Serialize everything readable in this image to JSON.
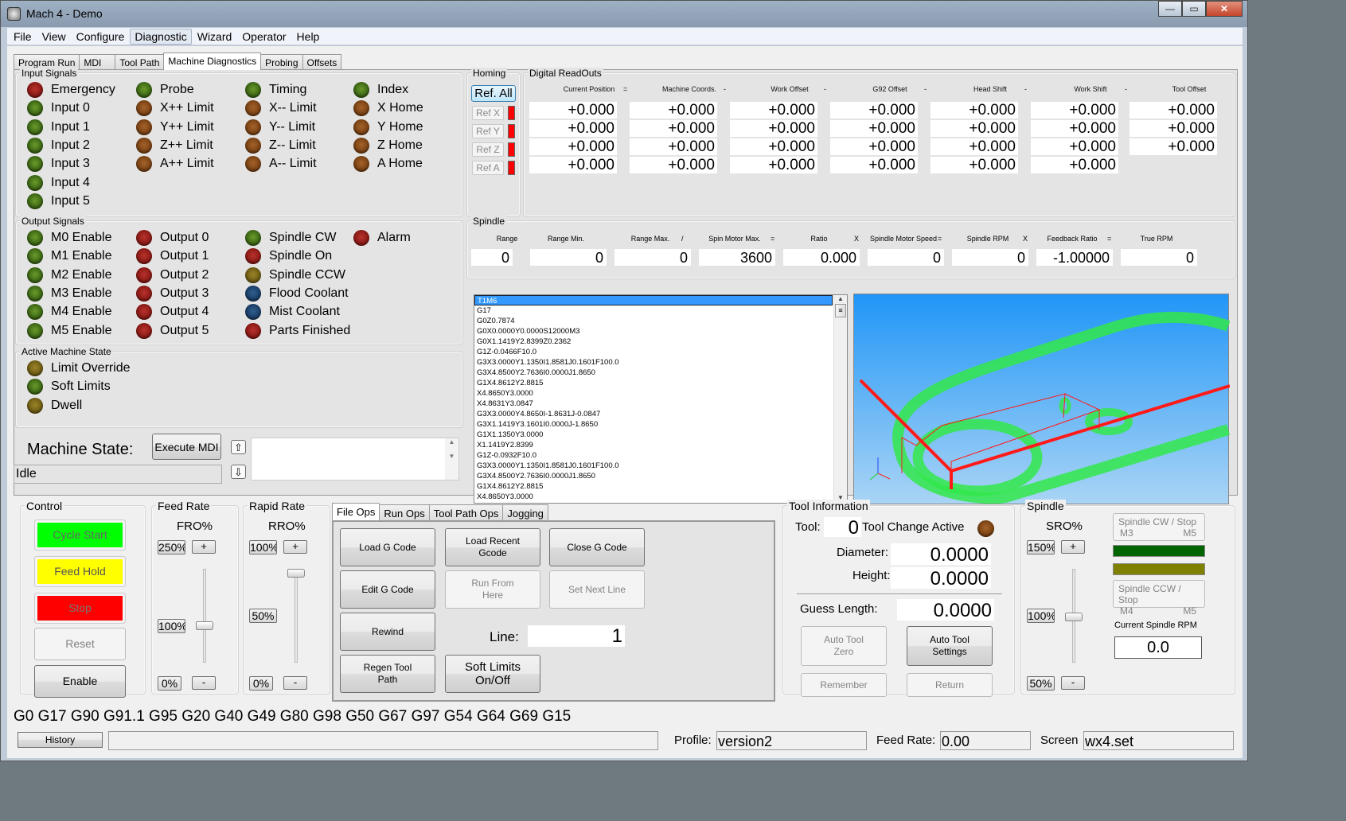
{
  "window": {
    "title": "Mach 4 - Demo",
    "buttons": {
      "minimize": "—",
      "maximize": "▭",
      "close": "✕"
    }
  },
  "menu": [
    "File",
    "View",
    "Configure",
    "Diagnostic",
    "Wizard",
    "Operator",
    "Help"
  ],
  "active_menu": "Diagnostic",
  "tabs": [
    "Program Run",
    "MDI",
    "Tool Path",
    "Machine Diagnostics",
    "Probing",
    "Offsets"
  ],
  "active_tab": "Machine Diagnostics",
  "input_signals": {
    "title": "Input Signals",
    "items": [
      {
        "label": "Emergency",
        "state": "red"
      },
      {
        "label": "Input 0",
        "state": "green"
      },
      {
        "label": "Input 1",
        "state": "green"
      },
      {
        "label": "Input 2",
        "state": "green"
      },
      {
        "label": "Input 3",
        "state": "green"
      },
      {
        "label": "Input 4",
        "state": "green"
      },
      {
        "label": "Input 5",
        "state": "green"
      },
      {
        "label": "Probe",
        "state": "green"
      },
      {
        "label": "X++ Limit",
        "state": "brown"
      },
      {
        "label": "Y++ Limit",
        "state": "brown"
      },
      {
        "label": "Z++ Limit",
        "state": "brown"
      },
      {
        "label": "A++ Limit",
        "state": "brown"
      },
      {
        "label": "Timing",
        "state": "green"
      },
      {
        "label": "X-- Limit",
        "state": "brown"
      },
      {
        "label": "Y-- Limit",
        "state": "brown"
      },
      {
        "label": "Z-- Limit",
        "state": "brown"
      },
      {
        "label": "A-- Limit",
        "state": "brown"
      },
      {
        "label": "Index",
        "state": "green"
      },
      {
        "label": "X Home",
        "state": "brown"
      },
      {
        "label": "Y Home",
        "state": "brown"
      },
      {
        "label": "Z Home",
        "state": "brown"
      },
      {
        "label": "A Home",
        "state": "brown"
      }
    ]
  },
  "output_signals": {
    "title": "Output Signals",
    "items": [
      {
        "label": "M0 Enable",
        "state": "green"
      },
      {
        "label": "M1 Enable",
        "state": "green"
      },
      {
        "label": "M2 Enable",
        "state": "green"
      },
      {
        "label": "M3 Enable",
        "state": "green"
      },
      {
        "label": "M4 Enable",
        "state": "green"
      },
      {
        "label": "M5 Enable",
        "state": "green"
      },
      {
        "label": "Output 0",
        "state": "red"
      },
      {
        "label": "Output 1",
        "state": "red"
      },
      {
        "label": "Output 2",
        "state": "red"
      },
      {
        "label": "Output 3",
        "state": "red"
      },
      {
        "label": "Output 4",
        "state": "red"
      },
      {
        "label": "Output 5",
        "state": "red"
      },
      {
        "label": "Spindle CW",
        "state": "green"
      },
      {
        "label": "Spindle On",
        "state": "red"
      },
      {
        "label": "Spindle CCW",
        "state": "olive"
      },
      {
        "label": "Flood Coolant",
        "state": "blue"
      },
      {
        "label": "Mist Coolant",
        "state": "blue"
      },
      {
        "label": "Parts Finished",
        "state": "red"
      },
      {
        "label": "Alarm",
        "state": "red"
      }
    ]
  },
  "active_machine_state": {
    "title": "Active Machine State",
    "items": [
      {
        "label": "Limit Override",
        "state": "olive"
      },
      {
        "label": "Soft Limits",
        "state": "green"
      },
      {
        "label": "Dwell",
        "state": "olive"
      }
    ]
  },
  "machine_state": {
    "label": "Machine State:",
    "value": "Idle",
    "execute_mdi": "Execute MDI"
  },
  "homing": {
    "title": "Homing",
    "ref_all": "Ref. All",
    "axes": [
      "Ref X",
      "Ref Y",
      "Ref Z",
      "Ref A"
    ]
  },
  "dro": {
    "title": "Digital ReadOuts",
    "headers": [
      "Current Position",
      "Machine Coords.",
      "Work Offset",
      "G92 Offset",
      "Head Shift",
      "Work Shift",
      "Tool Offset"
    ],
    "operators": [
      "=",
      "-",
      "-",
      "-",
      "-",
      "-"
    ],
    "rows": [
      [
        "+0.000",
        "+0.000",
        "+0.000",
        "+0.000",
        "+0.000",
        "+0.000",
        "+0.000"
      ],
      [
        "+0.000",
        "+0.000",
        "+0.000",
        "+0.000",
        "+0.000",
        "+0.000",
        "+0.000"
      ],
      [
        "+0.000",
        "+0.000",
        "+0.000",
        "+0.000",
        "+0.000",
        "+0.000",
        "+0.000"
      ],
      [
        "+0.000",
        "+0.000",
        "+0.000",
        "+0.000",
        "+0.000",
        "+0.000",
        null
      ]
    ]
  },
  "spindle_calc": {
    "title": "Spindle",
    "headers": [
      "Range",
      "Range Min.",
      "Range Max.",
      "Spin Motor Max.",
      "Ratio",
      "Spindle Motor Speed",
      "Spindle RPM",
      "Feedback Ratio",
      "True RPM"
    ],
    "operators": [
      "",
      "",
      "/",
      "=",
      "X",
      "=",
      "X",
      "="
    ],
    "values": [
      "0",
      "0",
      "0",
      "3600",
      "0.000",
      "0",
      "0",
      "-1.00000",
      "0"
    ]
  },
  "gcode_lines": [
    "T1M6",
    "G17",
    "G0Z0.7874",
    "G0X0.0000Y0.0000S12000M3",
    "G0X1.1419Y2.8399Z0.2362",
    "G1Z-0.0466F10.0",
    "G3X3.0000Y1.1350I1.8581J0.1601F100.0",
    "G3X4.8500Y2.7636I0.0000J1.8650",
    "G1X4.8612Y2.8815",
    "X4.8650Y3.0000",
    "X4.8631Y3.0847",
    "G3X3.0000Y4.8650I-1.8631J-0.0847",
    "G3X1.1419Y3.1601I0.0000J-1.8650",
    "G1X1.1350Y3.0000",
    "X1.1419Y2.8399",
    "G1Z-0.0932F10.0",
    "G3X3.0000Y1.1350I1.8581J0.1601F100.0",
    "G3X4.8500Y2.7636I0.0000J1.8650",
    "G1X4.8612Y2.8815",
    "X4.8650Y3.0000"
  ],
  "control": {
    "title": "Control",
    "cycle_start": "Cycle Start",
    "feed_hold": "Feed Hold",
    "stop": "Stop",
    "reset": "Reset",
    "enable": "Enable",
    "colors": {
      "cycle_start": "#00ff00",
      "feed_hold": "#ffff00",
      "stop": "#ff0000"
    }
  },
  "feed_rate": {
    "title": "Feed Rate",
    "label": "FRO%",
    "max": "250%",
    "current": "100%",
    "min": "0%",
    "value_percent": 100,
    "range_percent": [
      0,
      250
    ]
  },
  "rapid_rate": {
    "title": "Rapid Rate",
    "label": "RRO%",
    "max": "100%",
    "current": "50%",
    "min": "0%",
    "value_percent": 100,
    "range_percent": [
      0,
      100
    ]
  },
  "file_ops": {
    "tabs": [
      "File Ops",
      "Run Ops",
      "Tool Path Ops",
      "Jogging"
    ],
    "active_tab": "File Ops",
    "load_gcode": "Load G Code",
    "load_recent": "Load Recent Gcode",
    "close_gcode": "Close G Code",
    "edit_gcode": "Edit G Code",
    "run_from_here": "Run From Here",
    "set_next_line": "Set Next Line",
    "rewind": "Rewind",
    "line_label": "Line:",
    "line_value": "1",
    "regen": "Regen Tool Path",
    "soft_limits": "Soft Limits On/Off"
  },
  "tool_info": {
    "title": "Tool Information",
    "tool_label": "Tool:",
    "tool_value": "0",
    "tool_change_active": "Tool Change Active",
    "diameter_label": "Diameter:",
    "diameter_value": "0.0000",
    "height_label": "Height:",
    "height_value": "0.0000",
    "guess_label": "Guess Length:",
    "guess_value": "0.0000",
    "auto_tool_zero": "Auto Tool Zero",
    "auto_tool_settings": "Auto Tool Settings",
    "remember": "Remember",
    "return": "Return"
  },
  "spindle_panel": {
    "title": "Spindle",
    "label": "SRO%",
    "max": "150%",
    "current": "100%",
    "min": "50%",
    "value_percent": 100,
    "range_percent": [
      50,
      150
    ],
    "cw_stop": {
      "line1": "Spindle CW / Stop",
      "m_on": "M3",
      "m_off": "M5"
    },
    "ccw_stop": {
      "line1": "Spindle CCW / Stop",
      "m_on": "M4",
      "m_off": "M5"
    },
    "cw_indicator_color": "#006400",
    "ccw_indicator_color": "#808000",
    "current_rpm_label": "Current Spindle RPM",
    "current_rpm_value": "0.0"
  },
  "modal_codes": "G0 G17 G90 G91.1 G95 G20 G40 G49 G80 G98 G50 G67 G97 G54 G64 G69 G15",
  "status": {
    "history": "History",
    "message": "",
    "profile_label": "Profile:",
    "profile_value": "version2",
    "feed_label": "Feed Rate:",
    "feed_value": "0.00",
    "screen_label": "Screen",
    "screen_value": "wx4.set"
  }
}
